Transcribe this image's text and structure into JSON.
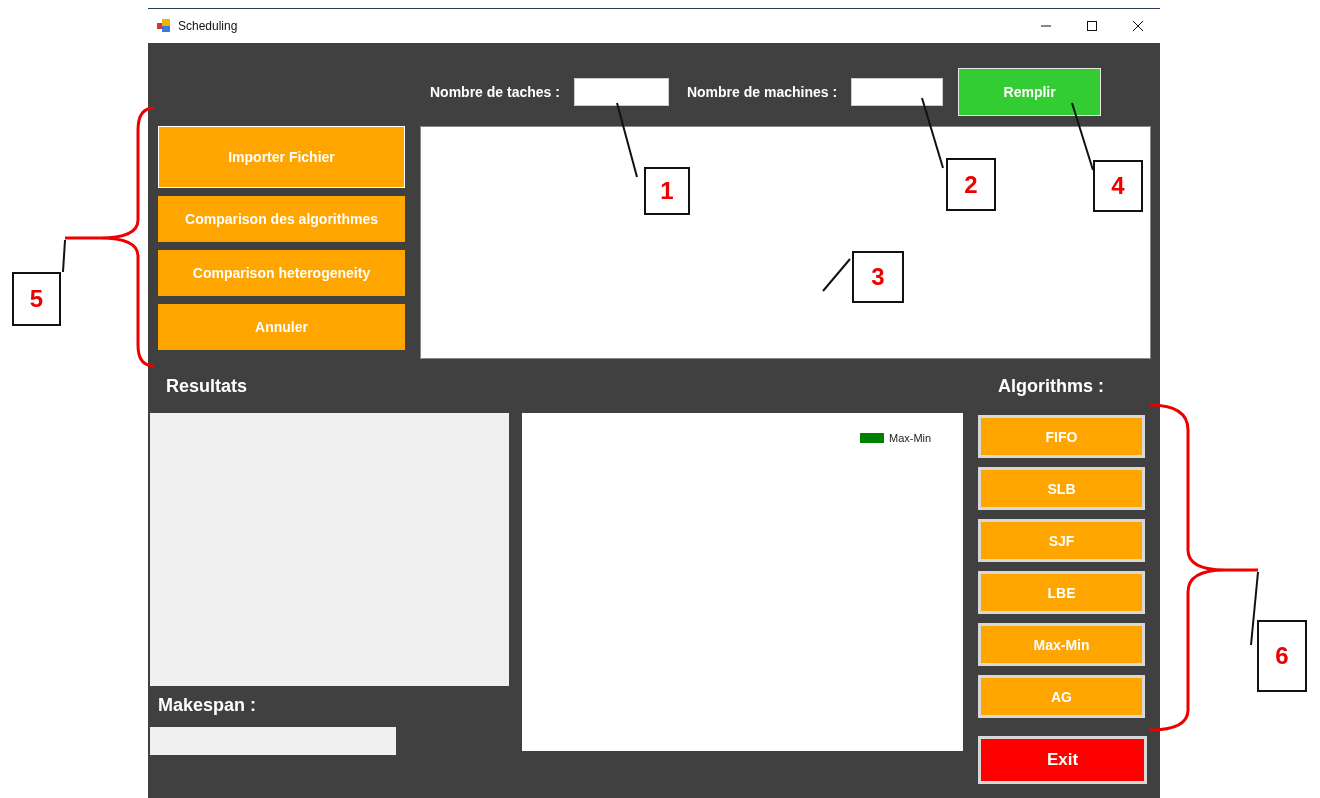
{
  "window": {
    "title": "Scheduling"
  },
  "inputs": [
    {
      "label": "Nombre de taches :"
    },
    {
      "label": "Nombre de machines :"
    }
  ],
  "fill_button": {
    "label": "Remplir"
  },
  "side_buttons": [
    {
      "label": "Importer Fichier",
      "focused": true
    },
    {
      "label": "Comparison des algorithmes",
      "focused": false
    },
    {
      "label": "Comparison heterogeneity",
      "focused": false
    },
    {
      "label": "Annuler",
      "focused": false
    }
  ],
  "results": {
    "title": "Resultats",
    "makespan_label": "Makespan :"
  },
  "chart": {
    "legend": [
      {
        "name": "Max-Min",
        "color": "#008000"
      }
    ]
  },
  "algorithms": {
    "title": "Algorithms :",
    "buttons": [
      "FIFO",
      "SLB",
      "SJF",
      "LBE",
      "Max-Min",
      "AG"
    ]
  },
  "exit_button": {
    "label": "Exit"
  },
  "callouts": [
    "1",
    "2",
    "3",
    "4",
    "5",
    "6"
  ]
}
